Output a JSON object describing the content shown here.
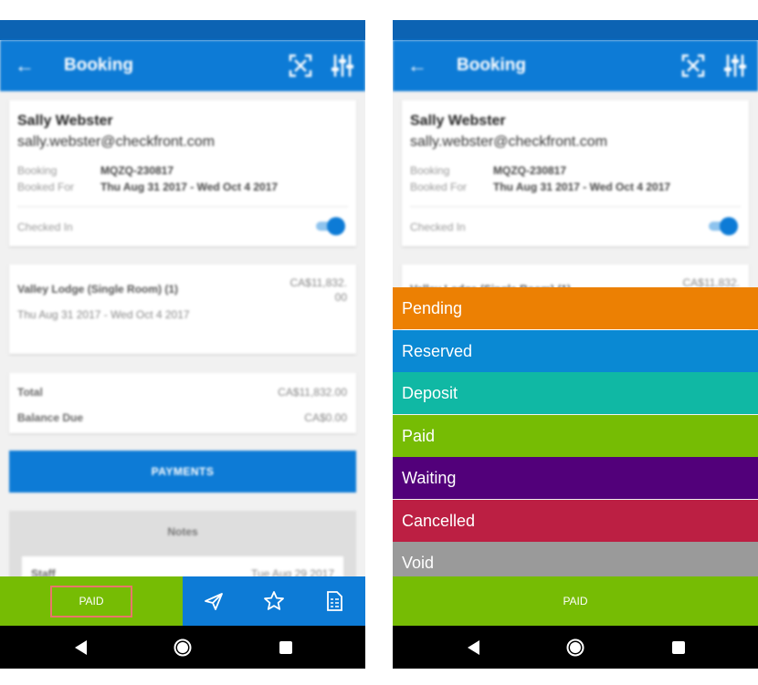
{
  "app_bar": {
    "title": "Booking",
    "back_icon": "arrow-back-icon",
    "scan_icon": "scan-icon",
    "filter_icon": "tune-icon"
  },
  "guest": {
    "name": "Sally Webster",
    "email": "sally.webster@checkfront.com",
    "booking_label": "Booking",
    "booking_value": "MQZQ-230817",
    "booked_for_label": "Booked For",
    "booked_for_value": "Thu Aug 31 2017 - Wed Oct 4 2017",
    "checked_in_label": "Checked In",
    "checked_in": true
  },
  "item": {
    "name": "Valley Lodge (Single Room) (1)",
    "dates": "Thu Aug 31 2017 - Wed Oct 4 2017",
    "price_line1": "CA$11,832.",
    "price_line2": "00"
  },
  "totals": {
    "total_label": "Total",
    "total_value": "CA$11,832.00",
    "balance_label": "Balance Due",
    "balance_value": "CA$0.00"
  },
  "payments_label": "PAYMENTS",
  "notes": {
    "title": "Notes",
    "entry_author": "Staff",
    "entry_date": "Tue Aug 29 2017"
  },
  "bottom_bar": {
    "status_label": "PAID",
    "icons": [
      "send-icon",
      "star-icon",
      "invoice-icon"
    ]
  },
  "status_menu": {
    "options": [
      {
        "label": "Pending",
        "color": "#ec8003"
      },
      {
        "label": "Reserved",
        "color": "#0a89d3"
      },
      {
        "label": "Deposit",
        "color": "#10b8a4"
      },
      {
        "label": "Paid",
        "color": "#76bc04"
      },
      {
        "label": "Waiting",
        "color": "#52007a"
      },
      {
        "label": "Cancelled",
        "color": "#bc1f43"
      },
      {
        "label": "Void",
        "color": "#9a9a9a"
      }
    ]
  },
  "right_bottom_bar": {
    "status_label": "PAID"
  }
}
